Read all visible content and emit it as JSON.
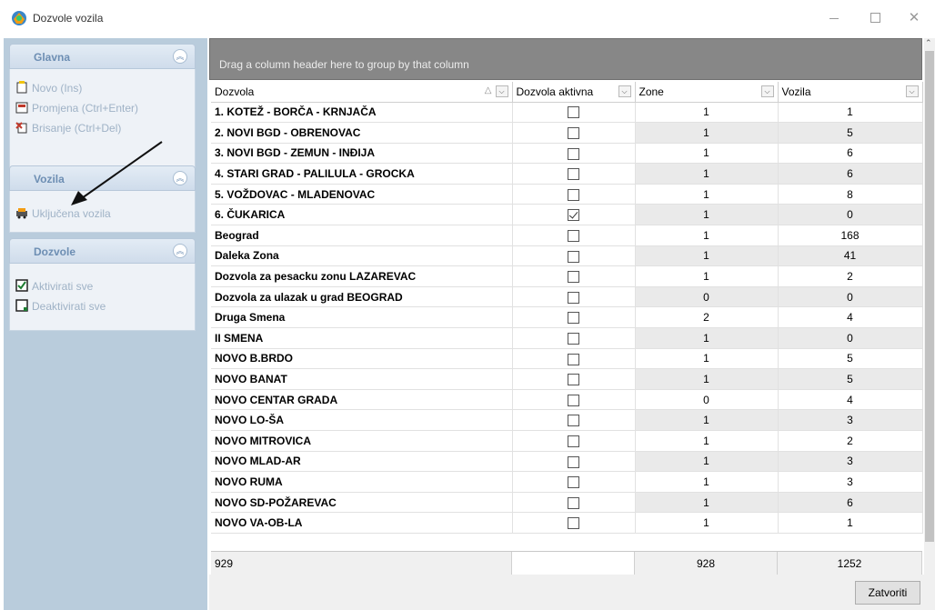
{
  "window": {
    "title": "Dozvole vozila",
    "minimize": "—",
    "maximize": "□",
    "close": "✕"
  },
  "nav": {
    "groups": [
      {
        "title": "Glavna",
        "items": [
          {
            "label": "Novo (Ins)",
            "icon": "new-doc-icon"
          },
          {
            "label": "Promjena (Ctrl+Enter)",
            "icon": "edit-icon"
          },
          {
            "label": "Brisanje (Ctrl+Del)",
            "icon": "delete-icon"
          }
        ]
      },
      {
        "title": "Vozila",
        "items": [
          {
            "label": "Uključena vozila",
            "icon": "vehicles-icon"
          }
        ]
      },
      {
        "title": "Dozvole",
        "items": [
          {
            "label": "Aktivirati sve",
            "icon": "activate-icon"
          },
          {
            "label": "Deaktivirati sve",
            "icon": "deactivate-icon"
          }
        ]
      }
    ]
  },
  "grid": {
    "group_panel_text": "Drag a column header here to group by that column",
    "columns": [
      "Dozvola",
      "Dozvola aktivna",
      "Zone",
      "Vozila"
    ],
    "rows": [
      {
        "name": "1. KOTEŽ - BORČA - KRNJAČA",
        "active": false,
        "zone": "1",
        "vozila": "1"
      },
      {
        "name": "2. NOVI BGD - OBRENOVAC",
        "active": false,
        "zone": "1",
        "vozila": "5"
      },
      {
        "name": "3. NOVI BGD - ZEMUN - INĐIJA",
        "active": false,
        "zone": "1",
        "vozila": "6"
      },
      {
        "name": "4. STARI GRAD - PALILULA - GROCKA",
        "active": false,
        "zone": "1",
        "vozila": "6"
      },
      {
        "name": "5. VOŽDOVAC - MLADENOVAC",
        "active": false,
        "zone": "1",
        "vozila": "8"
      },
      {
        "name": "6. ČUKARICA",
        "active": true,
        "zone": "1",
        "vozila": "0"
      },
      {
        "name": "Beograd",
        "active": false,
        "zone": "1",
        "vozila": "168"
      },
      {
        "name": "Daleka Zona",
        "active": false,
        "zone": "1",
        "vozila": "41"
      },
      {
        "name": "Dozvola za pesacku zonu LAZAREVAC",
        "active": false,
        "zone": "1",
        "vozila": "2"
      },
      {
        "name": "Dozvola za ulazak u grad BEOGRAD",
        "active": false,
        "zone": "0",
        "vozila": "0"
      },
      {
        "name": "Druga Smena",
        "active": false,
        "zone": "2",
        "vozila": "4"
      },
      {
        "name": "II SMENA",
        "active": false,
        "zone": "1",
        "vozila": "0"
      },
      {
        "name": "NOVO B.BRDO",
        "active": false,
        "zone": "1",
        "vozila": "5"
      },
      {
        "name": "NOVO BANAT",
        "active": false,
        "zone": "1",
        "vozila": "5"
      },
      {
        "name": "NOVO CENTAR GRADA",
        "active": false,
        "zone": "0",
        "vozila": "4"
      },
      {
        "name": "NOVO LO-ŠA",
        "active": false,
        "zone": "1",
        "vozila": "3"
      },
      {
        "name": "NOVO MITROVICA",
        "active": false,
        "zone": "1",
        "vozila": "2"
      },
      {
        "name": "NOVO MLAD-AR",
        "active": false,
        "zone": "1",
        "vozila": "3"
      },
      {
        "name": "NOVO RUMA",
        "active": false,
        "zone": "1",
        "vozila": "3"
      },
      {
        "name": "NOVO SD-POŽAREVAC",
        "active": false,
        "zone": "1",
        "vozila": "6"
      },
      {
        "name": "NOVO VA-OB-LA",
        "active": false,
        "zone": "1",
        "vozila": "1"
      }
    ],
    "footer": {
      "count": "929",
      "zone_sum": "928",
      "vozila_sum": "1252"
    }
  },
  "buttons": {
    "close": "Zatvoriti"
  }
}
